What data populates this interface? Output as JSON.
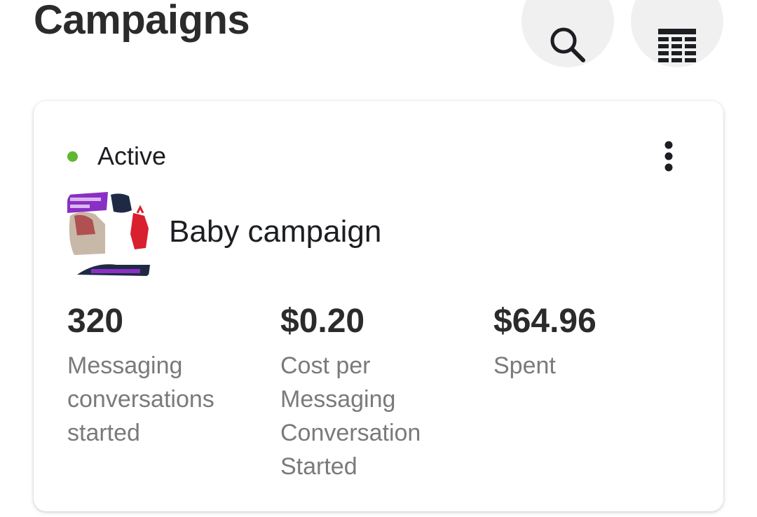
{
  "header": {
    "title": "Campaigns",
    "search_icon": "search-icon",
    "view_icon": "table-view-icon"
  },
  "campaign": {
    "status": "Active",
    "status_color": "#5fb830",
    "name": "Baby campaign",
    "more_icon": "more-vertical-icon",
    "metrics": [
      {
        "value": "320",
        "label_lines": [
          "Messaging",
          "conversations",
          "started"
        ]
      },
      {
        "value": "$0.20",
        "label_lines": [
          "Cost per",
          "Messaging",
          "Conversation",
          "Started"
        ]
      },
      {
        "value": "$64.96",
        "label_lines": [
          "Spent"
        ]
      }
    ]
  }
}
